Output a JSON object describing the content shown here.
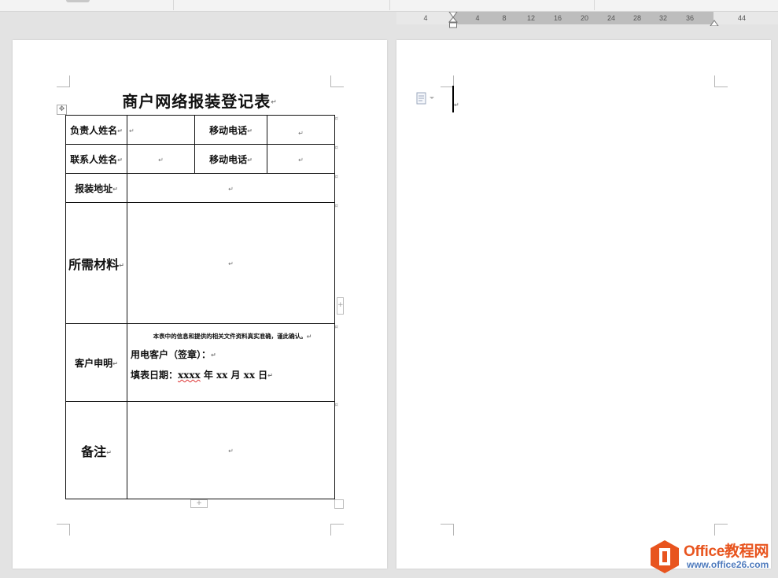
{
  "ruler": {
    "numbers": [
      "4",
      "4",
      "8",
      "12",
      "16",
      "20",
      "24",
      "28",
      "32",
      "36",
      "44"
    ]
  },
  "page1": {
    "title": "商户网络报装登记表",
    "paragraph_mark": "↵",
    "table": {
      "row1": {
        "label": "负责人姓名",
        "label2": "移动电话"
      },
      "row2": {
        "label": "联系人姓名",
        "label2": "移动电话"
      },
      "row3": {
        "label": "报装地址"
      },
      "row4": {
        "label": "所需材料"
      },
      "row5": {
        "label": "客户申明",
        "statement": "本表中的信息和提供的相关文件资料真实准确，谨此确认。",
        "signature": "用电客户（签章）：",
        "date_prefix": "填表日期：",
        "date_placeholder": "xxxx",
        "date_suffix": "年 xx 月 xx 日"
      },
      "row6": {
        "label": "备注"
      }
    }
  },
  "page2": {
    "paste_icon": "paste-options-icon"
  },
  "watermark": {
    "line1": "Office教程网",
    "line2": "www.office26.com",
    "colors": {
      "orange": "#e8541e",
      "blue": "#4f7bbd"
    }
  }
}
